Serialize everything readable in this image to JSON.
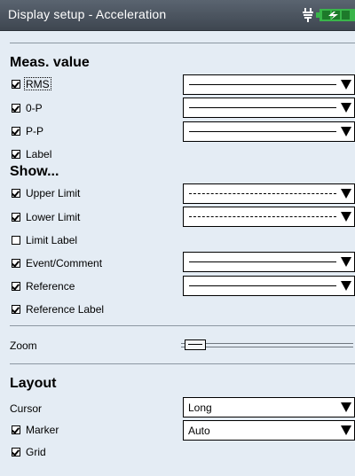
{
  "window": {
    "title": "Display setup - Acceleration",
    "status_icons": [
      "power-plug-icon",
      "battery-icon"
    ],
    "colors": {
      "titlebar": "#4a525c",
      "background": "#e4ecf4",
      "battery": "#39b54a"
    }
  },
  "meas_value": {
    "heading": "Meas. value",
    "rows": [
      {
        "label": "RMS",
        "checked": true,
        "line_style": "solid",
        "focused": true
      },
      {
        "label": "0-P",
        "checked": true,
        "line_style": "solid"
      },
      {
        "label": "P-P",
        "checked": true,
        "line_style": "solid"
      },
      {
        "label": "Label",
        "checked": true
      }
    ]
  },
  "show": {
    "heading": "Show...",
    "rows": [
      {
        "label": "Upper  Limit",
        "checked": true,
        "line_style": "dashed"
      },
      {
        "label": "Lower  Limit",
        "checked": true,
        "line_style": "dashed"
      },
      {
        "label": "Limit Label",
        "checked": false
      },
      {
        "label": "Event/Comment",
        "checked": true,
        "line_style": "solid"
      },
      {
        "label": "Reference",
        "checked": true,
        "line_style": "solid"
      },
      {
        "label": "Reference Label",
        "checked": true
      }
    ]
  },
  "zoom": {
    "label": "Zoom",
    "level": 0.02
  },
  "layout": {
    "heading": "Layout",
    "cursor_label": "Cursor",
    "cursor_value": "Long",
    "marker_label": "Marker",
    "marker_checked": true,
    "marker_value": "Auto",
    "grid_label": "Grid",
    "grid_checked": true
  }
}
